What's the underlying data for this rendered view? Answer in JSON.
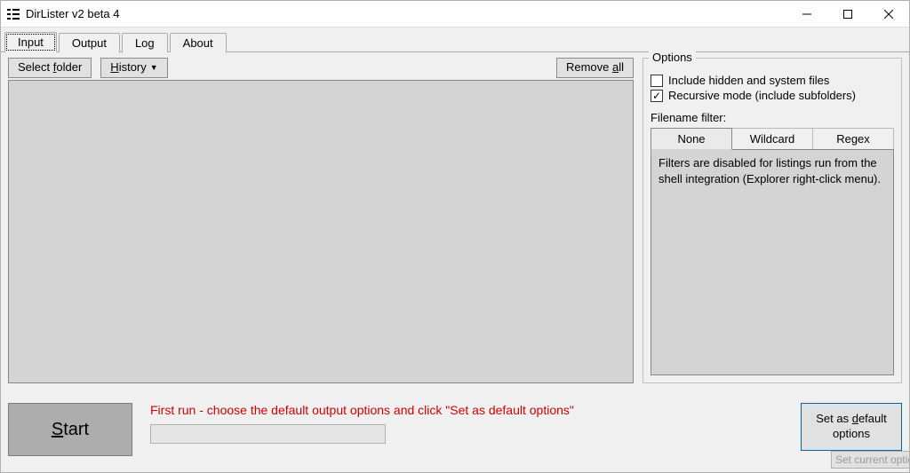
{
  "window": {
    "title": "DirLister v2 beta 4"
  },
  "tabs": {
    "input": "Input",
    "output": "Output",
    "log": "Log",
    "about": "About"
  },
  "toolbar": {
    "select_folder_pre": "Select ",
    "select_folder_ul": "f",
    "select_folder_post": "older",
    "history_ul": "H",
    "history_post": "istory",
    "remove_all_pre": "Remove ",
    "remove_all_ul": "a",
    "remove_all_post": "ll"
  },
  "options": {
    "legend": "Options",
    "include_hidden": "Include hidden and system files",
    "recursive": "Recursive mode (include subfolders)",
    "filter_label": "Filename filter:",
    "filter_tabs": {
      "none": "None",
      "wildcard": "Wildcard",
      "regex": "Regex"
    },
    "filter_body": "Filters are disabled for listings run from the shell integration (Explorer right-click menu)."
  },
  "bottom": {
    "start_ul": "S",
    "start_post": "tart",
    "hint": "First run - choose the default output options and click \"Set as default options\"",
    "setdef_pre": "Set as ",
    "setdef_ul": "d",
    "setdef_post": "efault options",
    "ghost": "Set current optio"
  }
}
